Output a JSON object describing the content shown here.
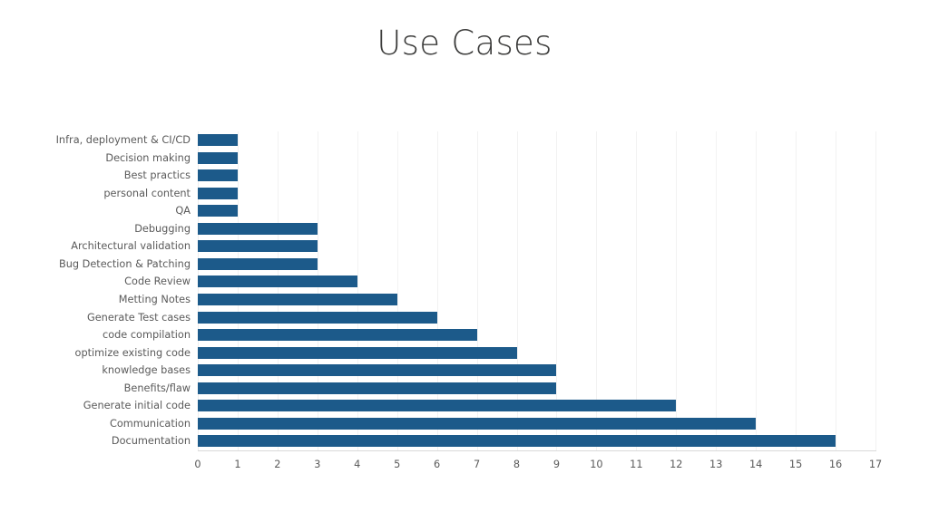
{
  "slide": {
    "title": "Use Cases",
    "background_color": "#ffffff"
  },
  "chart_data": {
    "type": "bar",
    "orientation": "horizontal",
    "title": "Use Cases",
    "xlabel": "",
    "ylabel": "",
    "xlim": [
      0,
      17
    ],
    "xticks": [
      "0",
      "1",
      "2",
      "3",
      "4",
      "5",
      "6",
      "7",
      "8",
      "9",
      "10",
      "11",
      "12",
      "13",
      "14",
      "15",
      "16",
      "17"
    ],
    "xtick_step": 1,
    "grid": true,
    "grid_axis": "x",
    "legend": false,
    "bar_color": "#1c5a8a",
    "label_color": "#5a5a5a",
    "gridline_color": "#f2f2f2",
    "axis_line_color": "#d9d9d9",
    "categories": [
      "Infra, deployment & CI/CD",
      "Decision making",
      "Best practics",
      "personal content",
      "QA",
      "Debugging",
      "Architectural validation",
      "Bug Detection & Patching",
      "Code Review",
      "Metting Notes",
      "Generate Test cases",
      "code compilation",
      "optimize existing code",
      "knowledge bases",
      "Benefits/flaw",
      "Generate initial code",
      "Communication",
      "Documentation"
    ],
    "values": [
      1,
      1,
      1,
      1,
      1,
      3,
      3,
      3,
      4,
      5,
      6,
      7,
      8,
      9,
      9,
      12,
      14,
      16
    ]
  }
}
